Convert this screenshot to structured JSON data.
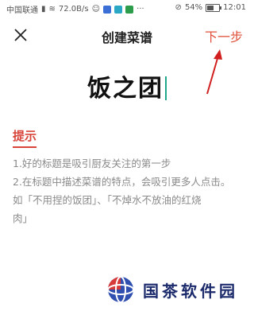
{
  "status_bar": {
    "carrier": "中国联通",
    "network_speed": "72.0B/s",
    "battery": "54%",
    "battery_level": 0.54,
    "time": "12:01"
  },
  "header": {
    "title": "创建菜谱",
    "next_label": "下一步",
    "accent_color": "#e0503a"
  },
  "dish": {
    "name": "饭之团"
  },
  "tips": {
    "title": "提示",
    "lines": [
      "1.好的标题是吸引厨友关注的第一步",
      "2.在标题中描述菜谱的特点，会吸引更多人点击。",
      "如「不用捏的饭团」、「不焯水不放油的红烧",
      "肉」"
    ]
  },
  "watermark": {
    "text": "国茶软件园"
  }
}
